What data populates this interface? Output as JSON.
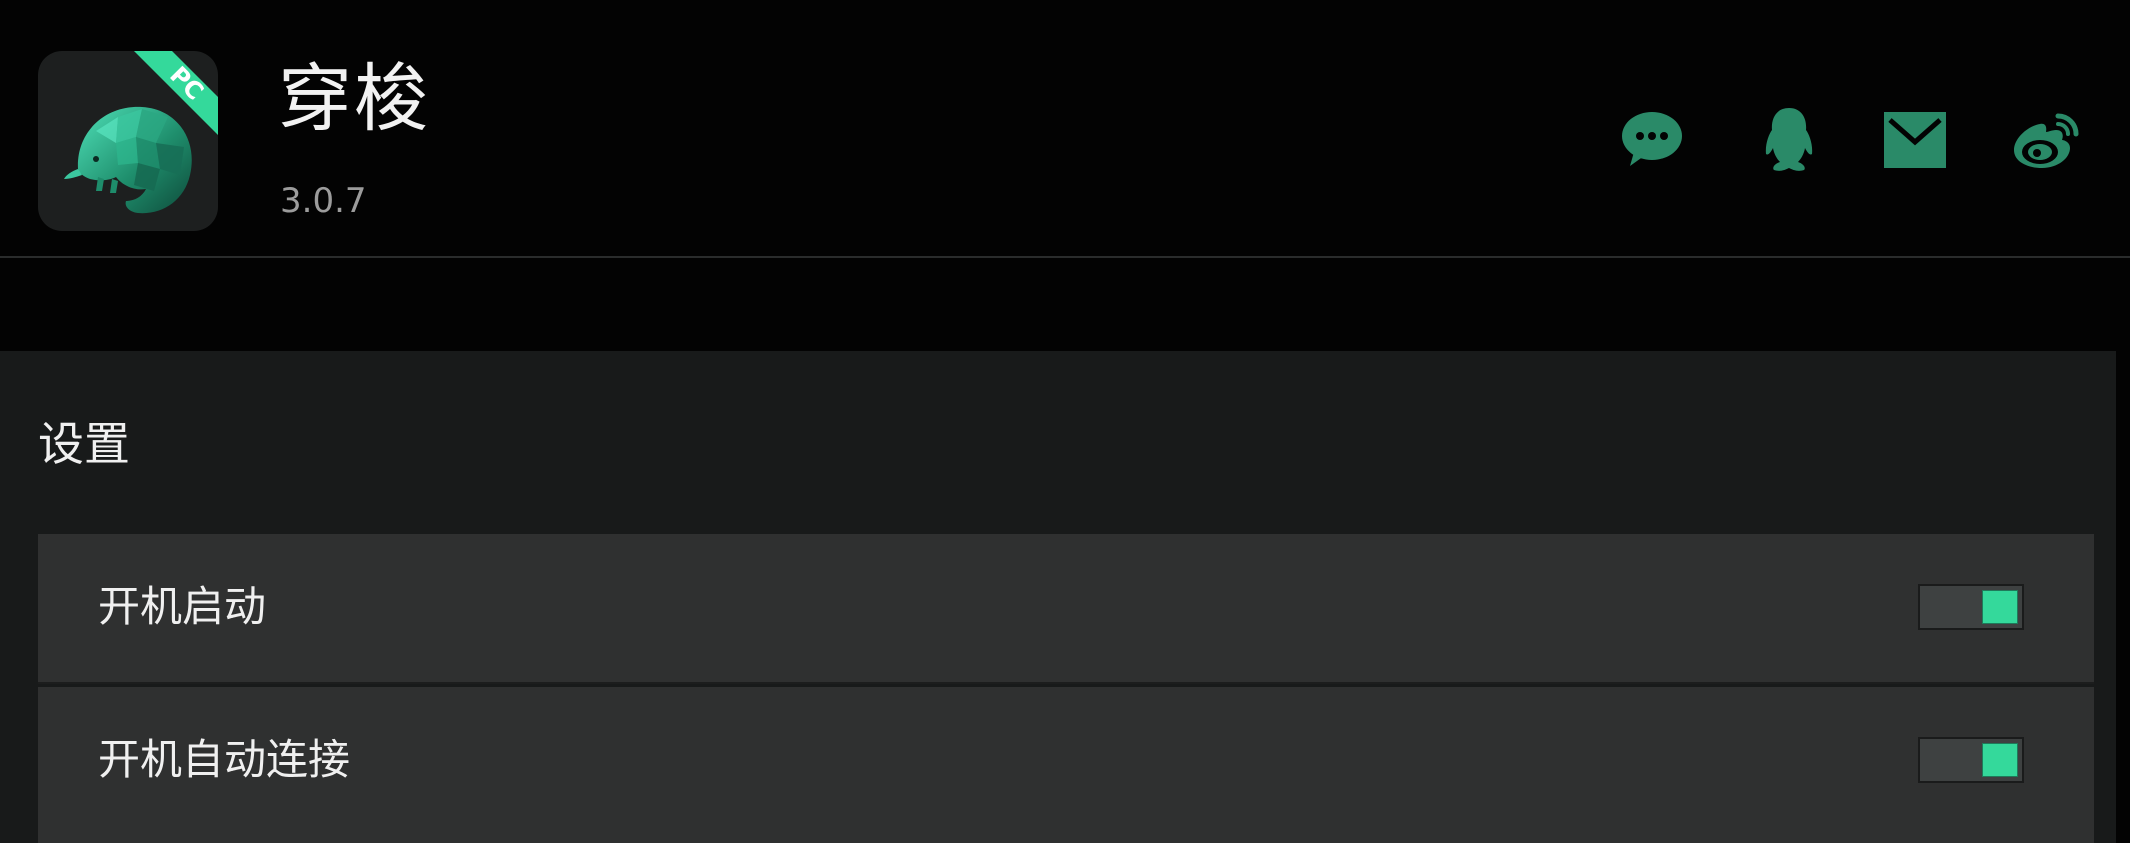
{
  "app": {
    "title": "穿梭",
    "version": "3.0.7",
    "icon_badge": "PC",
    "icon": "pangolin-logo",
    "accent_color": "#34d99b",
    "icon_color": "#2a8a68"
  },
  "social": [
    {
      "name": "wechat",
      "icon": "wechat-icon"
    },
    {
      "name": "qq",
      "icon": "qq-penguin-icon"
    },
    {
      "name": "email",
      "icon": "mail-icon"
    },
    {
      "name": "weibo",
      "icon": "weibo-icon"
    }
  ],
  "settings": {
    "title": "设置",
    "items": [
      {
        "label": "开机启动",
        "enabled": true
      },
      {
        "label": "开机自动连接",
        "enabled": true
      }
    ]
  }
}
